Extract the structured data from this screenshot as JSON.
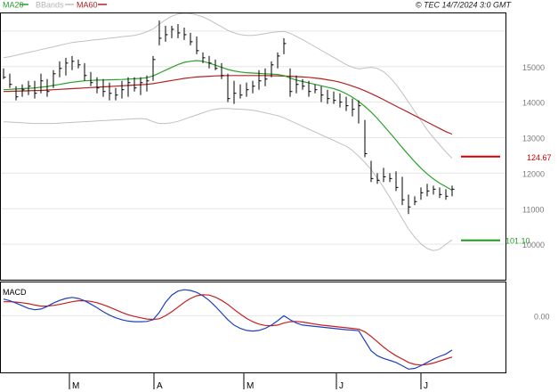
{
  "header": {
    "legend": [
      {
        "label": "MA20",
        "color": "#2ca02c",
        "swatch": "#2ca02c"
      },
      {
        "label": "BBands",
        "color": "#c0c0c0",
        "swatch": "#c0c0c0"
      },
      {
        "label": "MA60",
        "color": "#b22222",
        "swatch": "#b22222"
      }
    ],
    "copyright": "© TEC 14/7/2024 3:0 GMT"
  },
  "price_axis": {
    "ticks": [
      {
        "label": "15000",
        "value": 15000
      },
      {
        "label": "14000",
        "value": 14000
      },
      {
        "label": "13000",
        "value": 13000
      },
      {
        "label": "12000",
        "value": 12000
      },
      {
        "label": "11000",
        "value": 11000
      },
      {
        "label": "10000",
        "value": 10000
      }
    ]
  },
  "macd_panel": {
    "title": "MACD",
    "ticks": [
      {
        "label": "0.00",
        "value": 0
      }
    ]
  },
  "levels": {
    "resistance": {
      "label": "124.67",
      "value": 12467,
      "color": "#d40000"
    },
    "support": {
      "label": "101.10",
      "value": 10110,
      "color": "#1a9e1a"
    }
  },
  "months": [
    "M",
    "A",
    "M",
    "J",
    "J"
  ],
  "colors": {
    "grid": "#e6e6e6",
    "border": "#000000",
    "bars": "#000000",
    "ma20": "#2ca02c",
    "ma60": "#b22222",
    "bbands": "#c0c0c0",
    "macd_line": "#1f3fbf",
    "signal_line": "#c81e1e"
  },
  "chart_data": [
    {
      "type": "line",
      "panel": "price",
      "title": "",
      "xlabel": "",
      "ylabel": "",
      "ylim": [
        9000,
        16500
      ],
      "price_bars": [
        [
          14650,
          14950,
          14700
        ],
        [
          14400,
          14800,
          14500
        ],
        [
          14050,
          14450,
          14150
        ],
        [
          14150,
          14500,
          14350
        ],
        [
          14200,
          14600,
          14450
        ],
        [
          14100,
          14600,
          14250
        ],
        [
          14250,
          14800,
          14600
        ],
        [
          14150,
          14650,
          14300
        ],
        [
          14400,
          14900,
          14800
        ],
        [
          14700,
          15150,
          14950
        ],
        [
          14750,
          15250,
          15100
        ],
        [
          14900,
          15300,
          15150
        ],
        [
          14950,
          15200,
          15050
        ],
        [
          14600,
          15100,
          14750
        ],
        [
          14450,
          14850,
          14550
        ],
        [
          14250,
          14700,
          14400
        ],
        [
          14150,
          14650,
          14300
        ],
        [
          14050,
          14550,
          14250
        ],
        [
          14050,
          14400,
          14200
        ],
        [
          14100,
          14600,
          14350
        ],
        [
          14150,
          14700,
          14550
        ],
        [
          14300,
          14700,
          14400
        ],
        [
          14200,
          14700,
          14550
        ],
        [
          14300,
          14750,
          14600
        ],
        [
          14600,
          15300,
          15200
        ],
        [
          15600,
          16300,
          15800
        ],
        [
          15700,
          16150,
          15900
        ],
        [
          15800,
          16150,
          16050
        ],
        [
          15800,
          16200,
          15950
        ],
        [
          15750,
          16100,
          15900
        ],
        [
          15600,
          15950,
          15700
        ],
        [
          15350,
          15850,
          15450
        ],
        [
          15100,
          15400,
          15250
        ],
        [
          14950,
          15300,
          15100
        ],
        [
          14900,
          15200,
          14950
        ],
        [
          14650,
          15100,
          14750
        ],
        [
          14000,
          14800,
          14100
        ],
        [
          13950,
          14600,
          14250
        ],
        [
          14100,
          14500,
          14200
        ],
        [
          14150,
          14550,
          14350
        ],
        [
          14250,
          14600,
          14450
        ],
        [
          14350,
          14900,
          14600
        ],
        [
          14450,
          14950,
          14650
        ],
        [
          14700,
          15150,
          15050
        ],
        [
          14950,
          15400,
          15300
        ],
        [
          15350,
          15800,
          15650
        ],
        [
          14150,
          14950,
          14300
        ],
        [
          14250,
          14750,
          14500
        ],
        [
          14350,
          14650,
          14450
        ],
        [
          14150,
          14600,
          14300
        ],
        [
          14250,
          14500,
          14350
        ],
        [
          14000,
          14450,
          14200
        ],
        [
          13950,
          14350,
          14100
        ],
        [
          13950,
          14300,
          14050
        ],
        [
          13850,
          14250,
          14000
        ],
        [
          13750,
          14150,
          13900
        ],
        [
          13600,
          14100,
          13800
        ],
        [
          13400,
          14050,
          13900
        ],
        [
          12450,
          13500,
          12550
        ],
        [
          11750,
          12350,
          11850
        ],
        [
          11700,
          12000,
          11800
        ],
        [
          11750,
          12150,
          11900
        ],
        [
          11750,
          12000,
          11850
        ],
        [
          11500,
          12050,
          11600
        ],
        [
          11100,
          11900,
          11250
        ],
        [
          10850,
          11400,
          11050
        ],
        [
          11100,
          11350,
          11200
        ],
        [
          11250,
          11600,
          11450
        ],
        [
          11350,
          11700,
          11500
        ],
        [
          11400,
          11650,
          11550
        ],
        [
          11300,
          11600,
          11400
        ],
        [
          11250,
          11550,
          11350
        ],
        [
          11350,
          11650,
          11550
        ]
      ],
      "series": [
        {
          "name": "MA20",
          "values": [
            14350,
            14360,
            14370,
            14380,
            14390,
            14400,
            14420,
            14440,
            14470,
            14500,
            14530,
            14560,
            14580,
            14600,
            14610,
            14620,
            14625,
            14630,
            14635,
            14640,
            14650,
            14660,
            14670,
            14690,
            14740,
            14820,
            14900,
            14980,
            15060,
            15120,
            15150,
            15170,
            15150,
            15100,
            15040,
            14980,
            14920,
            14880,
            14850,
            14830,
            14820,
            14810,
            14800,
            14790,
            14780,
            14750,
            14680,
            14620,
            14580,
            14540,
            14500,
            14460,
            14420,
            14380,
            14320,
            14240,
            14140,
            14020,
            13880,
            13720,
            13540,
            13340,
            13140,
            12930,
            12720,
            12520,
            12320,
            12140,
            11980,
            11840,
            11720,
            11620,
            11520
          ]
        },
        {
          "name": "MA60",
          "values": [
            14300,
            14305,
            14310,
            14315,
            14320,
            14325,
            14330,
            14340,
            14350,
            14360,
            14370,
            14380,
            14390,
            14400,
            14410,
            14420,
            14430,
            14440,
            14450,
            14460,
            14470,
            14480,
            14490,
            14500,
            14520,
            14550,
            14580,
            14610,
            14640,
            14670,
            14690,
            14710,
            14720,
            14730,
            14740,
            14745,
            14750,
            14750,
            14750,
            14750,
            14750,
            14750,
            14750,
            14745,
            14740,
            14735,
            14730,
            14720,
            14710,
            14700,
            14680,
            14660,
            14630,
            14600,
            14560,
            14510,
            14450,
            14390,
            14320,
            14240,
            14160,
            14070,
            13980,
            13890,
            13800,
            13710,
            13620,
            13530,
            13440,
            13350,
            13260,
            13170,
            13100
          ]
        },
        {
          "name": "BBands",
          "values": [
            15250,
            15280,
            15320,
            15360,
            15400,
            15440,
            15480,
            15520,
            15560,
            15600,
            15640,
            15680,
            15700,
            15720,
            15740,
            15760,
            15780,
            15800,
            15820,
            15840,
            15860,
            15880,
            15920,
            15980,
            16060,
            16200,
            16320,
            16420,
            16480,
            16500,
            16490,
            16460,
            16400,
            16320,
            16220,
            16120,
            16020,
            15950,
            15900,
            15880,
            15880,
            15900,
            15930,
            15960,
            15980,
            15990,
            15940,
            15850,
            15760,
            15660,
            15560,
            15460,
            15360,
            15260,
            15160,
            15060,
            14980,
            14940,
            14960,
            14980,
            14950,
            14860,
            14700,
            14500,
            14260,
            14000,
            13740,
            13480,
            13220,
            13000,
            12800,
            12600,
            12420
          ]
        },
        {
          "name": "BBands",
          "values": [
            13450,
            13440,
            13430,
            13420,
            13410,
            13400,
            13400,
            13400,
            13400,
            13410,
            13420,
            13430,
            13440,
            13450,
            13460,
            13470,
            13480,
            13490,
            13500,
            13510,
            13520,
            13530,
            13540,
            13520,
            13450,
            13400,
            13400,
            13420,
            13460,
            13520,
            13580,
            13640,
            13700,
            13760,
            13800,
            13820,
            13820,
            13810,
            13800,
            13790,
            13770,
            13740,
            13700,
            13660,
            13620,
            13560,
            13480,
            13400,
            13320,
            13240,
            13160,
            13080,
            13000,
            12920,
            12840,
            12760,
            12640,
            12480,
            12300,
            12100,
            11860,
            11600,
            11320,
            11020,
            10720,
            10430,
            10200,
            10010,
            9880,
            9820,
            9860,
            10000,
            10120
          ]
        }
      ]
    },
    {
      "type": "line",
      "panel": "macd",
      "title": "MACD",
      "xlabel": "",
      "ylabel": "",
      "ylim": [
        -1.7,
        1.0
      ],
      "series": [
        {
          "name": "",
          "values": [
            0.5,
            0.45,
            0.38,
            0.3,
            0.22,
            0.18,
            0.2,
            0.28,
            0.38,
            0.46,
            0.52,
            0.55,
            0.52,
            0.45,
            0.35,
            0.24,
            0.12,
            0.02,
            -0.06,
            -0.12,
            -0.16,
            -0.18,
            -0.18,
            -0.17,
            -0.12,
            0.1,
            0.4,
            0.62,
            0.74,
            0.78,
            0.76,
            0.7,
            0.6,
            0.46,
            0.28,
            0.08,
            -0.12,
            -0.28,
            -0.38,
            -0.44,
            -0.46,
            -0.44,
            -0.38,
            -0.28,
            -0.15,
            0.0,
            -0.12,
            -0.22,
            -0.28,
            -0.3,
            -0.32,
            -0.34,
            -0.36,
            -0.38,
            -0.4,
            -0.42,
            -0.43,
            -0.45,
            -0.75,
            -1.05,
            -1.2,
            -1.28,
            -1.34,
            -1.4,
            -1.5,
            -1.6,
            -1.58,
            -1.5,
            -1.4,
            -1.3,
            -1.22,
            -1.15,
            -1.03
          ]
        },
        {
          "name": "",
          "values": [
            0.42,
            0.42,
            0.41,
            0.39,
            0.36,
            0.32,
            0.29,
            0.29,
            0.31,
            0.34,
            0.38,
            0.42,
            0.45,
            0.45,
            0.43,
            0.39,
            0.33,
            0.26,
            0.18,
            0.1,
            0.03,
            -0.02,
            -0.06,
            -0.1,
            -0.11,
            -0.09,
            0.0,
            0.12,
            0.26,
            0.4,
            0.52,
            0.6,
            0.63,
            0.62,
            0.56,
            0.46,
            0.34,
            0.19,
            0.05,
            -0.08,
            -0.18,
            -0.25,
            -0.29,
            -0.3,
            -0.28,
            -0.22,
            -0.18,
            -0.17,
            -0.19,
            -0.22,
            -0.25,
            -0.28,
            -0.3,
            -0.32,
            -0.34,
            -0.36,
            -0.38,
            -0.4,
            -0.48,
            -0.62,
            -0.78,
            -0.94,
            -1.08,
            -1.2,
            -1.3,
            -1.4,
            -1.46,
            -1.48,
            -1.46,
            -1.42,
            -1.36,
            -1.3,
            -1.24
          ]
        }
      ]
    }
  ]
}
